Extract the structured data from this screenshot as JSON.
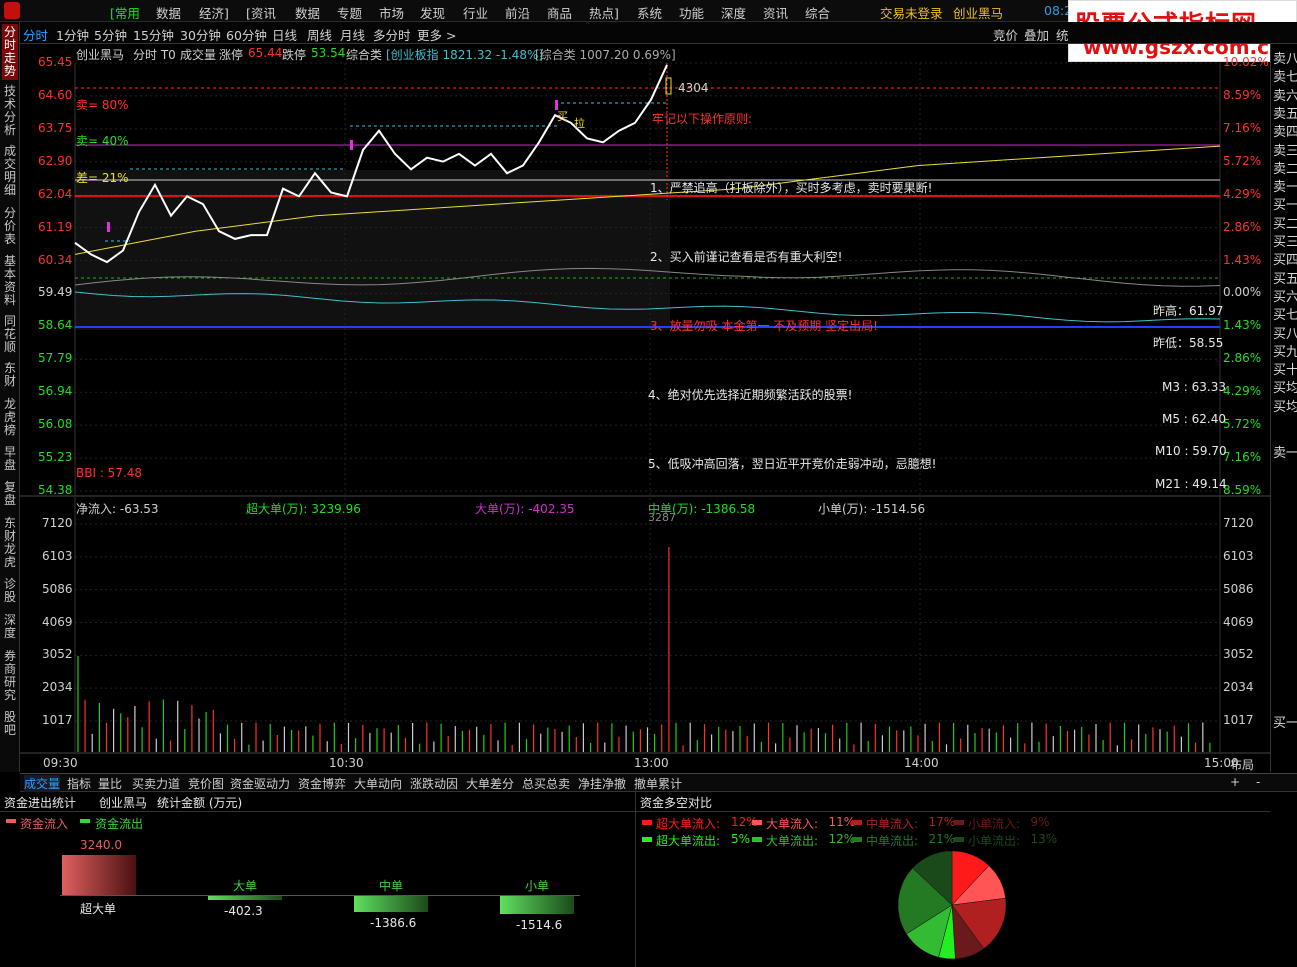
{
  "menubar": {
    "items": [
      "[常用",
      "数据",
      "经济]",
      "[资讯",
      "数据",
      "专题",
      "市场",
      "发现",
      "行业",
      "前沿",
      "商品",
      "热点]",
      "系统",
      "功能",
      "深度",
      "资讯",
      "综合"
    ],
    "login": "交易未登录",
    "stock": "创业黑马",
    "time": "08:2"
  },
  "tabbar": {
    "items": [
      "分时",
      "1分钟",
      "5分钟",
      "15分钟",
      "30分钟",
      "60分钟",
      "日线",
      "周线",
      "月线",
      "多分时",
      "更多 >"
    ],
    "right": [
      "竞价",
      "叠加",
      "统"
    ]
  },
  "leftnav": [
    "分时走势",
    "技术分析",
    "成交明细",
    "分价表",
    "基本资料",
    "同花顺",
    "东财",
    "龙虎榜",
    "早盘",
    "复盘",
    "东财龙虎",
    "诊股",
    "深度",
    "券商研究",
    "股吧"
  ],
  "header": {
    "name": "创业黑马",
    "mode": "分时 T0",
    "vol": "成交量",
    "zt_label": "涨停",
    "zt_val": "65.44",
    "dt_label": "跌停",
    "dt_val": "53.54",
    "zhl": "综合类",
    "idx1": "[创业板指 1821.32 -1.48%]",
    "idx2": "[综合类 1007.20 0.69%]"
  },
  "price_axis": [
    "65.45",
    "64.60",
    "63.75",
    "62.90",
    "62.04",
    "61.19",
    "60.34",
    "59.49",
    "58.64",
    "57.79",
    "56.94",
    "56.08",
    "55.23",
    "54.38"
  ],
  "pct_axis": [
    "10.02%",
    "8.59%",
    "7.16%",
    "5.72%",
    "4.29%",
    "2.86%",
    "1.43%",
    "0.00%",
    "1.43%",
    "2.86%",
    "4.29%",
    "5.72%",
    "7.16%",
    "8.59%"
  ],
  "vol_axis": [
    "7120",
    "6103",
    "5086",
    "4069",
    "3052",
    "2034",
    "1017"
  ],
  "time_axis": [
    "09:30",
    "10:30",
    "13:00",
    "14:00",
    "15:00"
  ],
  "time_axis_right": "布局",
  "annotations": {
    "sell80": "卖= 80%",
    "sell40": "卖= 40%",
    "diff21": "差= 21%",
    "bbi": "BBI : 57.48",
    "val4304": "4304",
    "val3287": "3287",
    "rules_title": "牢记以下操作原则:",
    "rule1": "1、严禁追高（打板除外），买时多考虑，卖时要果断!",
    "rule2": "2、买入前谨记查看是否有重大利空!",
    "rule3": "3、放量勿吸  本金第一  不及预期  坚定出局!",
    "rule4": "4、绝对优先选择近期频繁活跃的股票!",
    "rule5": "5、低吸冲高回落，翌日近平开竞价走弱冲动，忌臆想!",
    "prev_high_label": "昨高：61.97",
    "prev_low_label": "昨低：58.55",
    "m3": "M3 : 63.33",
    "m5": "M5 : 62.40",
    "m10": "M10 : 59.70",
    "m21": "M21 : 49.14",
    "mk_buy": "买",
    "mk_la": "拉"
  },
  "flow": {
    "net": "净流入: -63.53",
    "super": "超大单(万): 3239.96",
    "big": "大单(万): -402.35",
    "mid": "中单(万): -1386.58",
    "small": "小单(万): -1514.56"
  },
  "rightpanel": [
    "卖八",
    "卖七",
    "卖六",
    "卖五",
    "卖四",
    "卖三",
    "卖二",
    "卖一",
    "买一",
    "买二",
    "买三",
    "买四",
    "买五",
    "买六",
    "买七",
    "买八",
    "买九",
    "买十",
    "买均",
    "买均",
    "卖一",
    "买一"
  ],
  "bottomtabs": [
    "成交量",
    "指标",
    "量比",
    "买卖力道",
    "竞价图",
    "资金驱动力",
    "资金博弈",
    "大单动向",
    "涨跌动因",
    "大单差分",
    "总买总卖",
    "净挂净撤",
    "撤单累计"
  ],
  "bottomtabs_right": [
    "+",
    "-"
  ],
  "fund_stats": {
    "title": "资金进出统计",
    "stock": "创业黑马",
    "unit": "统计金额 (万元)",
    "legend_in": "资金流入",
    "legend_out": "资金流出",
    "bars": [
      {
        "name": "超大单",
        "value": "3240.0",
        "amount": 3240.0
      },
      {
        "name": "大单",
        "value": "-402.3",
        "amount": -402.3
      },
      {
        "name": "中单",
        "value": "-1386.6",
        "amount": -1386.6
      },
      {
        "name": "小单",
        "value": "-1514.6",
        "amount": -1514.6
      }
    ]
  },
  "pie": {
    "title": "资金多空对比",
    "legend": [
      {
        "label": "超大单流入:",
        "pct": "12%",
        "color": "#ff1a1a"
      },
      {
        "label": "大单流入:",
        "pct": "11%",
        "color": "#ff5555"
      },
      {
        "label": "中单流入:",
        "pct": "17%",
        "color": "#b02020"
      },
      {
        "label": "小单流入:",
        "pct": "9%",
        "color": "#6a1a1a"
      },
      {
        "label": "超大单流出:",
        "pct": "5%",
        "color": "#22ee22"
      },
      {
        "label": "大单流出:",
        "pct": "12%",
        "color": "#33bb33"
      },
      {
        "label": "中单流出:",
        "pct": "21%",
        "color": "#237a23"
      },
      {
        "label": "小单流出:",
        "pct": "13%",
        "color": "#1a4a1a"
      }
    ]
  },
  "chart_data": {
    "type": "line",
    "title": "创业黑马 分时",
    "price_range": [
      54.38,
      65.45
    ],
    "prev_close": 59.49,
    "x": [
      "09:30",
      "10:30",
      "13:00",
      "14:00",
      "15:00"
    ],
    "series": [
      {
        "name": "price",
        "values": [
          60.8,
          60.5,
          60.3,
          60.6,
          61.6,
          62.3,
          61.5,
          62.0,
          61.8,
          61.1,
          60.9,
          61.0,
          61.0,
          62.2,
          62.0,
          62.6,
          62.1,
          62.0,
          63.2,
          63.7,
          63.1,
          62.7,
          63.0,
          62.9,
          63.1,
          62.8,
          63.1,
          62.6,
          62.8,
          63.4,
          64.1,
          63.9,
          63.5,
          63.4,
          63.7,
          63.9,
          64.5,
          65.4
        ]
      },
      {
        "name": "avg",
        "values": [
          60.5,
          60.8,
          61.1,
          61.3,
          61.5,
          61.6,
          61.7,
          61.8,
          61.9,
          62.0,
          62.1,
          62.2,
          62.4,
          62.6,
          62.8,
          62.9,
          63.0,
          63.1,
          63.2,
          63.3
        ]
      }
    ],
    "volume_range": [
      0,
      7120
    ],
    "volume_peak": 6400
  },
  "watermark": {
    "cn": "股票公式指标网",
    "url": "www.gszx.com.cn"
  }
}
